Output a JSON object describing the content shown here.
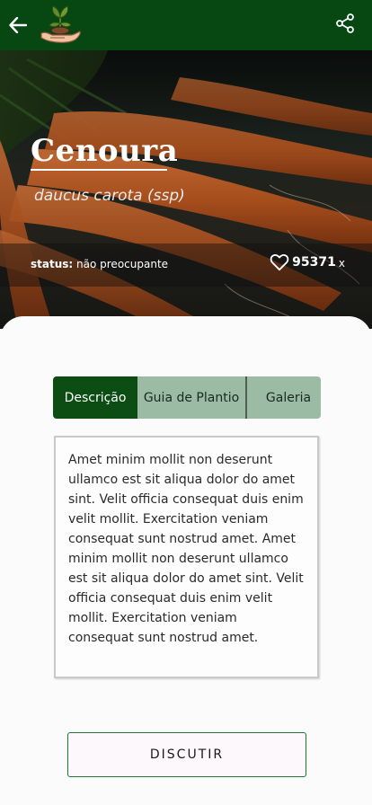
{
  "appbar": {
    "back_icon": "arrow-left-icon",
    "logo_icon": "hand-sprout-logo",
    "share_icon": "share-icon"
  },
  "plant": {
    "name": "Cenoura",
    "scientific_name": "daucus carota (ssp)",
    "status_label": "status:",
    "status_value": "não preocupante",
    "likes_count": "95371",
    "likes_suffix": "x"
  },
  "tabs": [
    {
      "label": "Descrição",
      "active": true
    },
    {
      "label": "Guia de Plantio",
      "active": false
    },
    {
      "label": "Galeria",
      "active": false
    }
  ],
  "description": "Amet minim mollit non deserunt ullamco est sit aliqua dolor do amet sint. Velit officia consequat duis enim velit mollit. Exercitation veniam consequat sunt nostrud amet. Amet minim mollit non deserunt ullamco est sit aliqua dolor do amet sint. Velit officia consequat duis enim velit mollit. Exercitation veniam consequat sunt nostrud amet.",
  "discuss_button": "DISCUTIR",
  "colors": {
    "primary": "#064712",
    "tab_inactive": "#9bbba5",
    "button_border": "#1d7a34"
  }
}
